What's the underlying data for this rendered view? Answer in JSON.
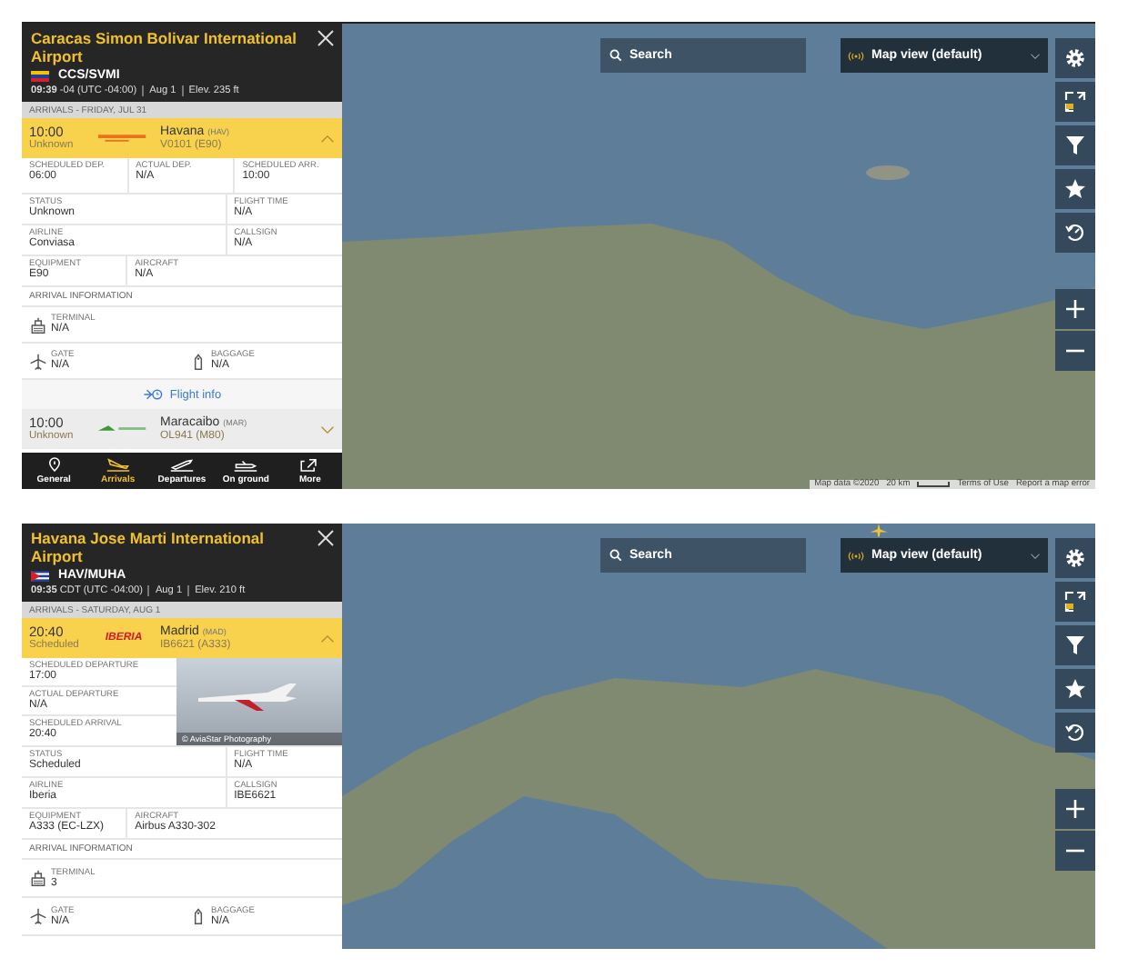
{
  "panels": [
    {
      "airport": {
        "name": "Caracas Simon Bolivar International Airport",
        "code": "CCS/SVMI",
        "info": [
          "**09:39** -04 (UTC -04:00)",
          "Aug 1",
          "Elev. 235 ft"
        ]
      },
      "list_heading": "ARRIVALS - FRIDAY, JUL 31",
      "flights": [
        {
          "time": "10:00",
          "status": "Unknown",
          "city": "Havana",
          "city_code": "(HAV)",
          "flight": "V0101 (E90)",
          "expanded": true,
          "detail_rows": [
            [
              {
                "label": "SCHEDULED DEP.",
                "value": "06:00"
              },
              {
                "label": "ACTUAL DEP.",
                "value": "N/A"
              },
              {
                "label": "SCHEDULED ARR.",
                "value": "10:00"
              }
            ],
            [
              {
                "label": "STATUS",
                "value": "Unknown"
              },
              {
                "label": "FLIGHT TIME",
                "value": "N/A"
              }
            ],
            [
              {
                "label": "AIRLINE",
                "value": "Conviasa"
              },
              {
                "label": "CALLSIGN",
                "value": "N/A"
              }
            ],
            [
              {
                "label": "EQUIPMENT",
                "value": "E90"
              },
              {
                "label": "AIRCRAFT",
                "value": "N/A"
              }
            ]
          ],
          "arrival": {
            "heading": "ARRIVAL INFORMATION",
            "terminal": {
              "label": "TERMINAL",
              "value": "N/A"
            },
            "gate": {
              "label": "GATE",
              "value": "N/A"
            },
            "baggage": {
              "label": "BAGGAGE",
              "value": "N/A"
            }
          },
          "flight_info": "Flight info"
        },
        {
          "time": "10:00",
          "status": "Unknown",
          "city": "Maracaibo",
          "city_code": "(MAR)",
          "flight": "OL941 (M80)",
          "expanded": false
        }
      ],
      "nav": [
        {
          "label": "General",
          "selected": false
        },
        {
          "label": "Arrivals",
          "selected": true
        },
        {
          "label": "Departures",
          "selected": false
        },
        {
          "label": "On ground",
          "selected": false
        },
        {
          "label": "More",
          "selected": false
        }
      ],
      "map": {
        "search": "Search",
        "view": "Map view (default)",
        "aircraft_marker": false,
        "attribution": [
          "Map data ©2020",
          "20 km",
          "Terms of Use",
          "Report a map error"
        ]
      }
    },
    {
      "airport": {
        "name": "Havana Jose Marti International Airport",
        "code": "HAV/MUHA",
        "info": [
          "**09:35** CDT (UTC -04:00)",
          "Aug 1",
          "Elev. 210 ft"
        ]
      },
      "list_heading": "ARRIVALS - SATURDAY, AUG 1",
      "flights": [
        {
          "time": "20:40",
          "status": "Scheduled",
          "logo_text": "IBERIA",
          "city": "Madrid",
          "city_code": "(MAD)",
          "flight": "IB6621 (A333)",
          "expanded": true,
          "photo": {
            "credit": "© AviaStar Photography"
          },
          "side_rows": [
            {
              "label": "SCHEDULED DEPARTURE",
              "value": "17:00"
            },
            {
              "label": "ACTUAL DEPARTURE",
              "value": "N/A"
            },
            {
              "label": "SCHEDULED ARRIVAL",
              "value": "20:40"
            }
          ],
          "detail_rows": [
            [
              {
                "label": "STATUS",
                "value": "Scheduled"
              },
              {
                "label": "FLIGHT TIME",
                "value": "N/A"
              }
            ],
            [
              {
                "label": "AIRLINE",
                "value": "Iberia"
              },
              {
                "label": "CALLSIGN",
                "value": "IBE6621"
              }
            ],
            [
              {
                "label": "EQUIPMENT",
                "value": "A333 (EC-LZX)"
              },
              {
                "label": "AIRCRAFT",
                "value": "Airbus A330-302"
              }
            ]
          ],
          "arrival": {
            "heading": "ARRIVAL INFORMATION",
            "terminal": {
              "label": "TERMINAL",
              "value": "3"
            },
            "gate": {
              "label": "GATE",
              "value": "N/A"
            },
            "baggage": {
              "label": "BAGGAGE",
              "value": "N/A"
            }
          }
        }
      ],
      "map": {
        "search": "Search",
        "view": "Map view (default)",
        "aircraft_marker": true
      }
    }
  ]
}
